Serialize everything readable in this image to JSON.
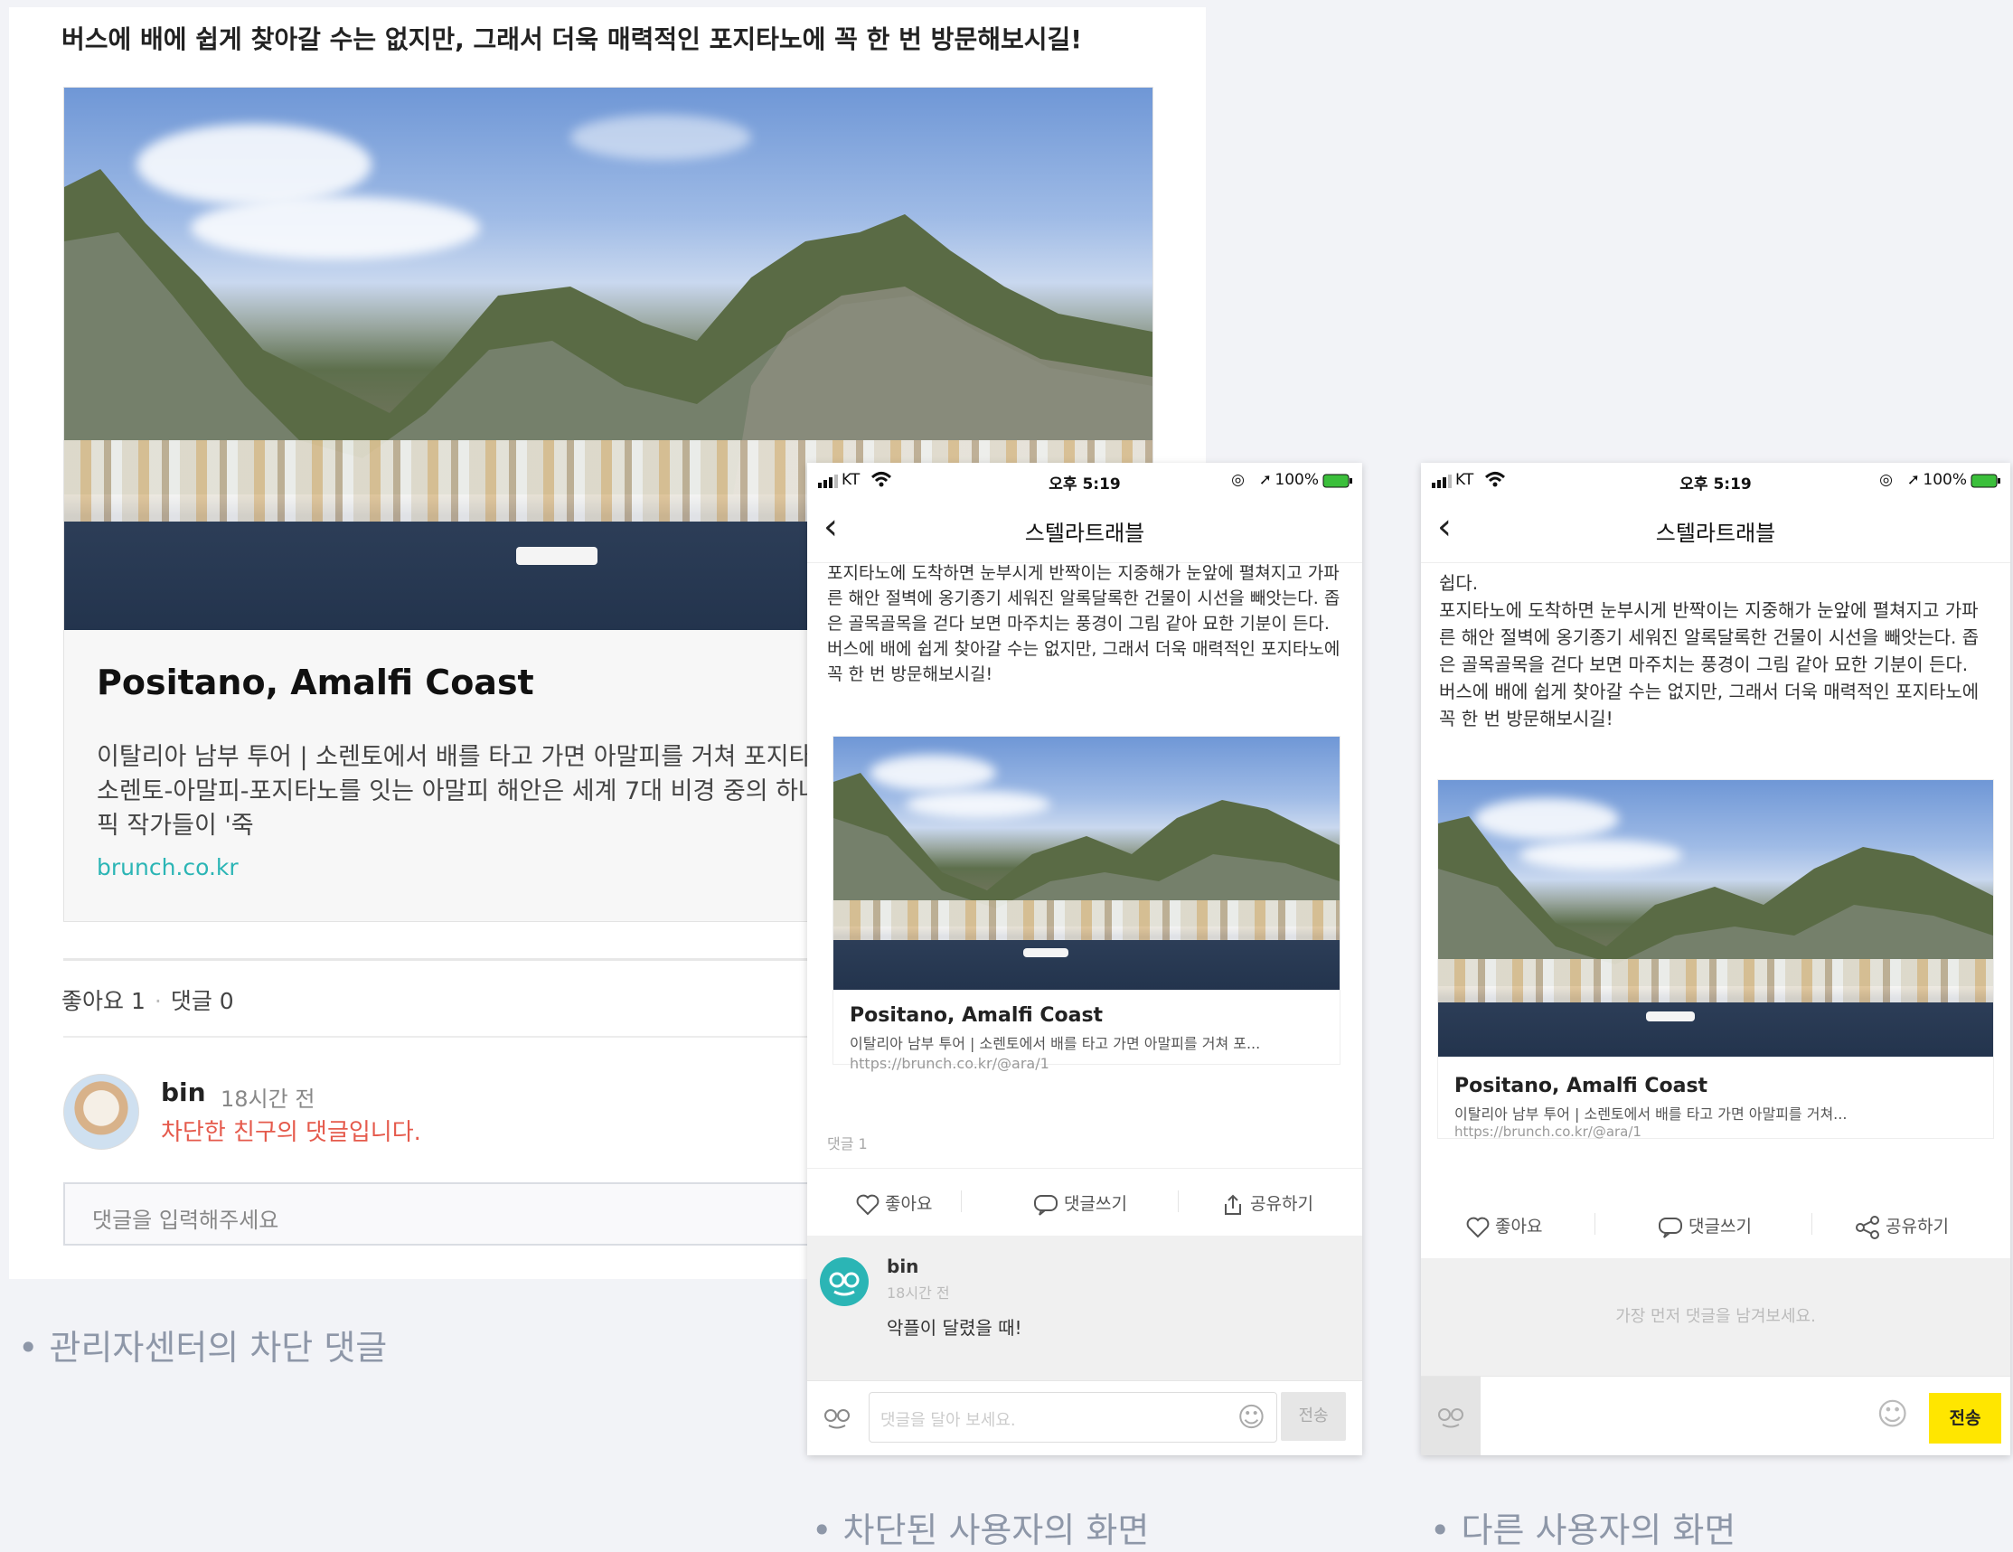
{
  "admin": {
    "top_text": "버스에 배에 쉽게 찾아갈 수는 없지만, 그래서 더욱 매력적인 포지타노에 꼭 한 번 방문해보시길!",
    "card": {
      "title": "Positano, Amalfi Coast",
      "description": "이탈리아 남부 투어 | 소렌토에서 배를 타고 가면 아말피를 거쳐 포지타노 소렌토-아말피-포지타노를 잇는 아말피 해안은 세계 7대 비경 중의 하나 픽 작가들이 '죽",
      "url": "brunch.co.kr"
    },
    "stats": {
      "likes": "좋아요 1",
      "comments": "댓글 0"
    },
    "comment": {
      "name": "bin",
      "time": "18시간 전",
      "blocked_text": "차단한 친구의 댓글입니다."
    },
    "input_placeholder": "댓글을 입력해주세요"
  },
  "blocked_phone": {
    "status": {
      "carrier": "KT",
      "time": "오후 5:19",
      "battery": "100%"
    },
    "title": "스텔라트래블",
    "post_text": "포지타노에 도착하면 눈부시게 반짝이는 지중해가 눈앞에 펼쳐지고 가파른 해안 절벽에 옹기종기 세워진 알록달록한 건물이 시선을 빼앗는다. 좁은 골목골목을 걷다 보면 마주치는 풍경이 그림 같아 묘한 기분이 든다.\n버스에 배에 쉽게 찾아갈 수는 없지만, 그래서 더욱 매력적인 포지타노에 꼭 한 번 방문해보시길!",
    "card": {
      "title": "Positano, Amalfi Coast",
      "description": "이탈리아 남부 투어 | 소렌토에서 배를 타고 가면 아말피를 거쳐 포...",
      "url": "https://brunch.co.kr/@ara/1"
    },
    "comment_count": "댓글 1",
    "actions": {
      "like": "좋아요",
      "comment": "댓글쓰기",
      "share": "공유하기"
    },
    "comment": {
      "name": "bin",
      "time": "18시간 전",
      "text": "악플이 달렸을 때!"
    },
    "input_placeholder": "댓글을 달아 보세요.",
    "send": "전송"
  },
  "other_phone": {
    "status": {
      "carrier": "KT",
      "time": "오후 5:19",
      "battery": "100%"
    },
    "title": "스텔라트래블",
    "post_text": "쉽다.\n포지타노에 도착하면 눈부시게 반짝이는 지중해가 눈앞에 펼쳐지고 가파른 해안 절벽에 옹기종기 세워진 알록달록한 건물이 시선을 빼앗는다. 좁은 골목골목을 걷다 보면 마주치는 풍경이 그림 같아 묘한 기분이 든다.\n버스에 배에 쉽게 찾아갈 수는 없지만, 그래서 더욱 매력적인 포지타노에 꼭 한 번 방문해보시길!",
    "card": {
      "title": "Positano, Amalfi Coast",
      "description": "이탈리아 남부 투어 | 소렌토에서 배를 타고 가면 아말피를 거쳐...",
      "url": "https://brunch.co.kr/@ara/1"
    },
    "actions": {
      "like": "좋아요",
      "comment": "댓글쓰기",
      "share": "공유하기"
    },
    "empty_comment": "가장 먼저 댓글을 남겨보세요.",
    "send": "전송"
  },
  "captions": {
    "admin": "• 관리자센터의 차단 댓글",
    "blocked": "• 차단된 사용자의 화면",
    "other": "• 다른 사용자의 화면"
  },
  "colors": {
    "accent_teal": "#2bb5b5",
    "blocked_red": "#e55a4c",
    "send_yellow": "#ffe600"
  },
  "icons": [
    "signal-icon",
    "wifi-icon",
    "location-icon",
    "battery-icon",
    "back-chevron-icon",
    "heart-icon",
    "comment-bubble-icon",
    "share-icon",
    "avatar-icon",
    "emoji-icon"
  ]
}
